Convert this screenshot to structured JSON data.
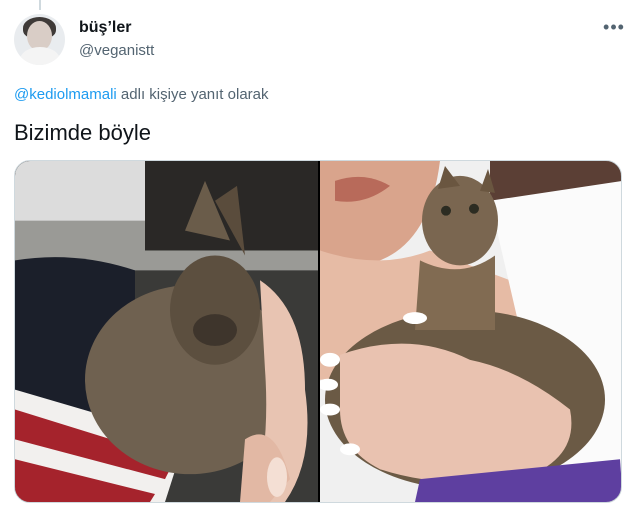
{
  "tweet": {
    "display_name": "büş’ler",
    "handle": "@veganistt",
    "more_icon": "more-horizontal-icon",
    "more_glyph": "•••",
    "reply_to_handle": "@kediolmamali",
    "reply_suffix": " adlı kişiye yanıt olarak",
    "text": "Bizimde böyle",
    "media": [
      {
        "name": "kitten-photo-left"
      },
      {
        "name": "kitten-photo-right"
      }
    ]
  }
}
